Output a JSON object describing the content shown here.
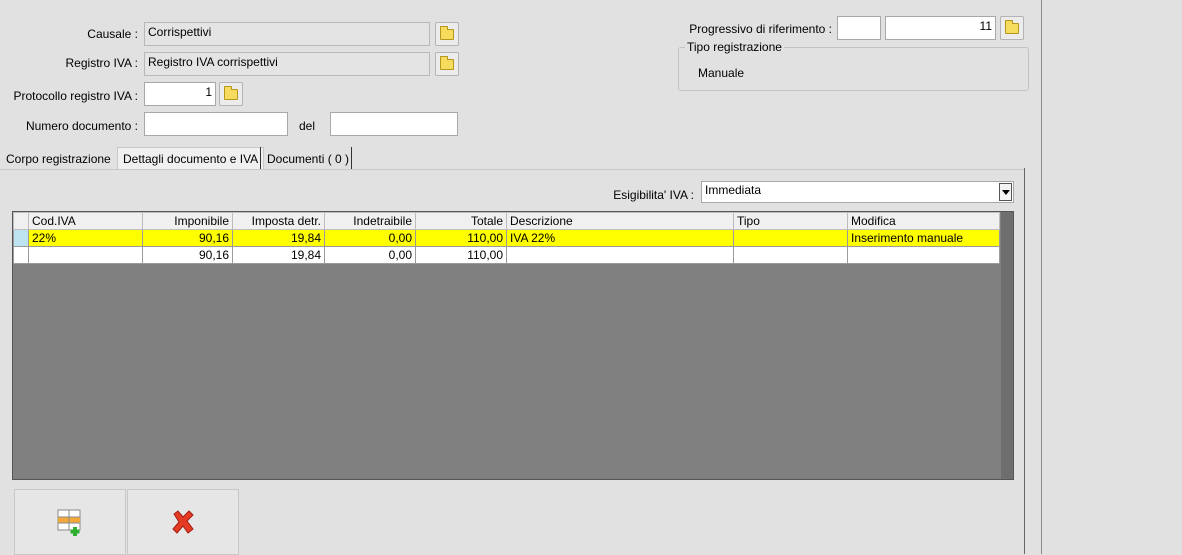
{
  "form": {
    "causale": {
      "label": "Causale :",
      "value": "Corrispettivi"
    },
    "registro_iva": {
      "label": "Registro IVA :",
      "value": "Registro IVA corrispettivi"
    },
    "protocollo": {
      "label": "Protocollo registro IVA :",
      "value": "1"
    },
    "numero_documento": {
      "label": "Numero documento :",
      "value": "",
      "del_label": "del",
      "del_value": ""
    },
    "progressivo": {
      "label": "Progressivo di riferimento :",
      "value1": "",
      "value2": "11"
    },
    "tipo_registrazione": {
      "legend": "Tipo registrazione",
      "value": "Manuale"
    }
  },
  "tabs": [
    {
      "label": "Corpo registrazione"
    },
    {
      "label": "Dettagli documento e IVA"
    },
    {
      "label": "Documenti ( 0 )"
    }
  ],
  "esigibilita": {
    "label": "Esigibilita' IVA :",
    "value": "Immediata"
  },
  "grid": {
    "columns": [
      "Cod.IVA",
      "Imponibile",
      "Imposta detr.",
      "Indetraibile",
      "Totale",
      "Descrizione",
      "Tipo",
      "Modifica"
    ],
    "rows": [
      [
        "22%",
        "90,16",
        "19,84",
        "0,00",
        "110,00",
        "IVA 22%",
        "",
        "Inserimento manuale"
      ],
      [
        "",
        "90,16",
        "19,84",
        "0,00",
        "110,00",
        "",
        "",
        ""
      ]
    ]
  },
  "icons": {
    "folder": "folder-icon",
    "add": "add-row-icon",
    "delete": "delete-icon"
  },
  "colors": {
    "selected_row": "#ffff00",
    "grid_bg": "#808080"
  }
}
